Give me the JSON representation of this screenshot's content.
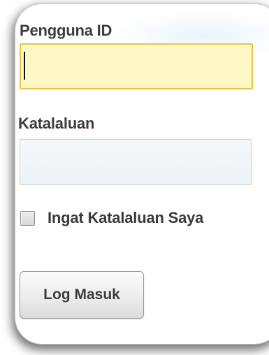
{
  "login_form": {
    "user_id_label": "Pengguna ID",
    "user_id_value": "",
    "password_label": "Katalaluan",
    "password_value": "",
    "remember_me_label": "Ingat Katalaluan Saya",
    "remember_me_checked": false,
    "login_button_label": "Log Masuk"
  },
  "colors": {
    "focused_input_bg": "#fff8c6",
    "focused_input_border": "#e7c54a",
    "label_text": "#3c3c3c"
  }
}
